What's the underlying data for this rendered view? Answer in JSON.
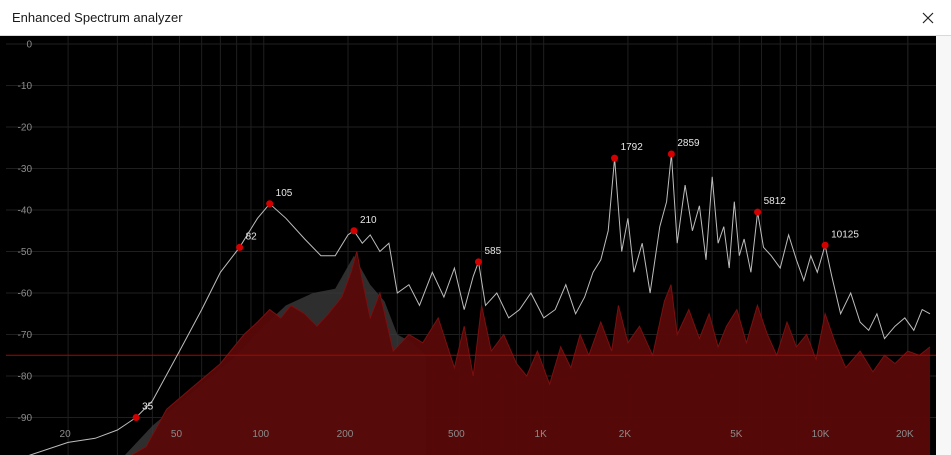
{
  "window": {
    "title": "Enhanced Spectrum analyzer",
    "close_icon": "close-icon"
  },
  "colors": {
    "background": "#000000",
    "grid": "#1f1f1f",
    "axis_text": "#8c8c8c",
    "peak_line": "#bdbdbd",
    "spectrum_fill": "#5a0808",
    "spectrum_shadow": "#3a3a3a",
    "peak_marker": "#d40000",
    "threshold_line": "#b30000"
  },
  "chart_data": {
    "type": "area",
    "xscale": "log",
    "xlim": [
      12,
      24000
    ],
    "ylim": [
      -100,
      0
    ],
    "grid": true,
    "y_ticks": [
      "0",
      "-10",
      "-20",
      "-30",
      "-40",
      "-50",
      "-60",
      "-70",
      "-80",
      "-90"
    ],
    "y_tick_values": [
      0,
      -10,
      -20,
      -30,
      -40,
      -50,
      -60,
      -70,
      -80,
      -90
    ],
    "x_ticks": [
      "20",
      "50",
      "100",
      "200",
      "500",
      "1K",
      "2K",
      "5K",
      "10K",
      "20K"
    ],
    "x_tick_values": [
      20,
      50,
      100,
      200,
      500,
      1000,
      2000,
      5000,
      10000,
      20000
    ],
    "threshold_db": -75,
    "peaks": [
      {
        "label": "35",
        "freq": 35,
        "db": -90
      },
      {
        "label": "82",
        "freq": 82,
        "db": -49
      },
      {
        "label": "105",
        "freq": 105,
        "db": -38.5
      },
      {
        "label": "210",
        "freq": 210,
        "db": -45
      },
      {
        "label": "585",
        "freq": 585,
        "db": -52.5
      },
      {
        "label": "1792",
        "freq": 1792,
        "db": -27.5
      },
      {
        "label": "2859",
        "freq": 2859,
        "db": -26.5
      },
      {
        "label": "5812",
        "freq": 5812,
        "db": -40.5
      },
      {
        "label": "10125",
        "freq": 10125,
        "db": -48.5
      }
    ],
    "series": [
      {
        "key": "peak_hold",
        "x": [
          12,
          20,
          25,
          30,
          35,
          40,
          50,
          60,
          70,
          82,
          95,
          105,
          120,
          140,
          160,
          180,
          200,
          210,
          225,
          240,
          260,
          280,
          300,
          330,
          360,
          400,
          440,
          480,
          520,
          560,
          585,
          620,
          680,
          750,
          820,
          900,
          1000,
          1100,
          1200,
          1300,
          1400,
          1500,
          1600,
          1700,
          1792,
          1900,
          2000,
          2100,
          2250,
          2400,
          2600,
          2750,
          2859,
          3000,
          3200,
          3400,
          3600,
          3800,
          4000,
          4200,
          4400,
          4600,
          4800,
          5000,
          5200,
          5500,
          5812,
          6100,
          6500,
          7000,
          7500,
          8000,
          8500,
          9000,
          9500,
          10125,
          10700,
          11500,
          12500,
          13500,
          14500,
          15500,
          16500,
          18000,
          19500,
          21000,
          22500,
          24000
        ],
        "y": [
          -101,
          -96,
          -95,
          -93,
          -90,
          -86,
          -74,
          -64,
          -55,
          -49,
          -42,
          -38.5,
          -42,
          -47,
          -51,
          -51,
          -46,
          -45,
          -48,
          -46,
          -50,
          -48,
          -60,
          -58,
          -63,
          -55,
          -61,
          -54,
          -64,
          -56,
          -52.5,
          -63,
          -60,
          -66,
          -64,
          -60,
          -66,
          -64,
          -58,
          -65,
          -61,
          -55,
          -52,
          -45,
          -27.5,
          -50,
          -42,
          -55,
          -48,
          -60,
          -44,
          -38,
          -26.5,
          -48,
          -34,
          -45,
          -39,
          -52,
          -32,
          -48,
          -44,
          -54,
          -38,
          -51,
          -47,
          -55,
          -40.5,
          -49,
          -51,
          -54,
          -46,
          -52,
          -57,
          -51,
          -55,
          -48.5,
          -56,
          -65,
          -60,
          -67,
          -69,
          -65,
          -71,
          -68,
          -66,
          -69,
          -64,
          -65
        ]
      },
      {
        "key": "shadow",
        "x": [
          12,
          30,
          40,
          60,
          80,
          100,
          120,
          150,
          180,
          210,
          240,
          270,
          300,
          340,
          380
        ],
        "y": [
          -101,
          -101,
          -92,
          -82,
          -75,
          -68,
          -63,
          -60,
          -59,
          -51,
          -58,
          -62,
          -70,
          -72,
          -75
        ]
      },
      {
        "key": "current",
        "x": [
          12,
          30,
          38,
          45,
          55,
          70,
          85,
          95,
          105,
          115,
          125,
          140,
          155,
          170,
          190,
          205,
          215,
          225,
          240,
          260,
          290,
          330,
          370,
          420,
          480,
          520,
          560,
          600,
          650,
          720,
          800,
          870,
          950,
          1050,
          1150,
          1250,
          1350,
          1450,
          1600,
          1750,
          1850,
          2000,
          2200,
          2450,
          2700,
          2850,
          3000,
          3300,
          3600,
          3900,
          4200,
          4500,
          4900,
          5300,
          5800,
          6300,
          6800,
          7400,
          8000,
          8700,
          9400,
          10125,
          11000,
          12000,
          13500,
          15000,
          16500,
          18000,
          20000,
          22000,
          24000
        ],
        "y": [
          -101,
          -101,
          -97,
          -88,
          -83,
          -77,
          -70,
          -67,
          -64,
          -66,
          -63,
          -65,
          -68,
          -65,
          -61,
          -55,
          -50,
          -57,
          -66,
          -60,
          -74,
          -70,
          -72,
          -66,
          -78,
          -68,
          -80,
          -63,
          -74,
          -70,
          -77,
          -80,
          -74,
          -82,
          -73,
          -78,
          -70,
          -75,
          -67,
          -74,
          -63,
          -72,
          -68,
          -75,
          -62,
          -58,
          -70,
          -64,
          -71,
          -65,
          -73,
          -68,
          -64,
          -72,
          -63,
          -70,
          -75,
          -67,
          -73,
          -70,
          -76,
          -65,
          -72,
          -78,
          -74,
          -79,
          -75,
          -77,
          -74,
          -75,
          -73
        ]
      }
    ]
  }
}
